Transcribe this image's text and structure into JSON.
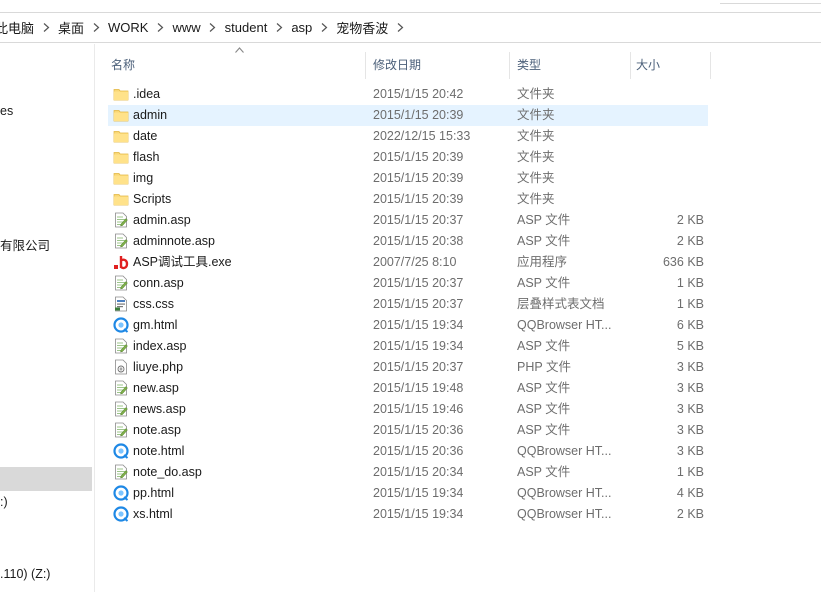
{
  "breadcrumb": [
    "此电脑",
    "桌面",
    "WORK",
    "www",
    "student",
    "asp",
    "宠物香波"
  ],
  "nav": {
    "items": [
      {
        "label": "es"
      },
      {
        "label": "有限公司"
      },
      {
        "label": "",
        "selected": true
      },
      {
        "label": ":)"
      },
      {
        "label": ".110) (Z:)"
      }
    ]
  },
  "columns": {
    "name": "名称",
    "date": "修改日期",
    "type": "类型",
    "size": "大小"
  },
  "files": [
    {
      "name": ".idea",
      "date": "2015/1/15 20:42",
      "type": "文件夹",
      "size": "",
      "icon": "folder-icon"
    },
    {
      "name": "admin",
      "date": "2015/1/15 20:39",
      "type": "文件夹",
      "size": "",
      "icon": "folder-icon",
      "hover": true
    },
    {
      "name": "date",
      "date": "2022/12/15 15:33",
      "type": "文件夹",
      "size": "",
      "icon": "folder-icon"
    },
    {
      "name": "flash",
      "date": "2015/1/15 20:39",
      "type": "文件夹",
      "size": "",
      "icon": "folder-icon"
    },
    {
      "name": "img",
      "date": "2015/1/15 20:39",
      "type": "文件夹",
      "size": "",
      "icon": "folder-icon"
    },
    {
      "name": "Scripts",
      "date": "2015/1/15 20:39",
      "type": "文件夹",
      "size": "",
      "icon": "folder-icon"
    },
    {
      "name": "admin.asp",
      "date": "2015/1/15 20:37",
      "type": "ASP 文件",
      "size": "2 KB",
      "icon": "asp-file-icon"
    },
    {
      "name": "adminnote.asp",
      "date": "2015/1/15 20:38",
      "type": "ASP 文件",
      "size": "2 KB",
      "icon": "asp-file-icon"
    },
    {
      "name": "ASP调试工具.exe",
      "date": "2007/7/25 8:10",
      "type": "应用程序",
      "size": "636 KB",
      "icon": "exe-icon"
    },
    {
      "name": "conn.asp",
      "date": "2015/1/15 20:37",
      "type": "ASP 文件",
      "size": "1 KB",
      "icon": "asp-file-icon"
    },
    {
      "name": "css.css",
      "date": "2015/1/15 20:37",
      "type": "层叠样式表文档",
      "size": "1 KB",
      "icon": "css-file-icon"
    },
    {
      "name": "gm.html",
      "date": "2015/1/15 19:34",
      "type": "QQBrowser HT...",
      "size": "6 KB",
      "icon": "browser-html-icon"
    },
    {
      "name": "index.asp",
      "date": "2015/1/15 19:34",
      "type": "ASP 文件",
      "size": "5 KB",
      "icon": "asp-file-icon"
    },
    {
      "name": "liuye.php",
      "date": "2015/1/15 20:37",
      "type": "PHP 文件",
      "size": "3 KB",
      "icon": "php-file-icon"
    },
    {
      "name": "new.asp",
      "date": "2015/1/15 19:48",
      "type": "ASP 文件",
      "size": "3 KB",
      "icon": "asp-file-icon"
    },
    {
      "name": "news.asp",
      "date": "2015/1/15 19:46",
      "type": "ASP 文件",
      "size": "3 KB",
      "icon": "asp-file-icon"
    },
    {
      "name": "note.asp",
      "date": "2015/1/15 20:36",
      "type": "ASP 文件",
      "size": "3 KB",
      "icon": "asp-file-icon"
    },
    {
      "name": "note.html",
      "date": "2015/1/15 20:36",
      "type": "QQBrowser HT...",
      "size": "3 KB",
      "icon": "browser-html-icon"
    },
    {
      "name": "note_do.asp",
      "date": "2015/1/15 20:34",
      "type": "ASP 文件",
      "size": "1 KB",
      "icon": "asp-file-icon"
    },
    {
      "name": "pp.html",
      "date": "2015/1/15 19:34",
      "type": "QQBrowser HT...",
      "size": "4 KB",
      "icon": "browser-html-icon"
    },
    {
      "name": "xs.html",
      "date": "2015/1/15 19:34",
      "type": "QQBrowser HT...",
      "size": "2 KB",
      "icon": "browser-html-icon"
    }
  ],
  "colors": {
    "hover": "#e5f3ff",
    "folder": "#f8d775",
    "header_text": "#4c607a",
    "exe_red": "#e02020",
    "browser_blue": "#1e88e5"
  }
}
